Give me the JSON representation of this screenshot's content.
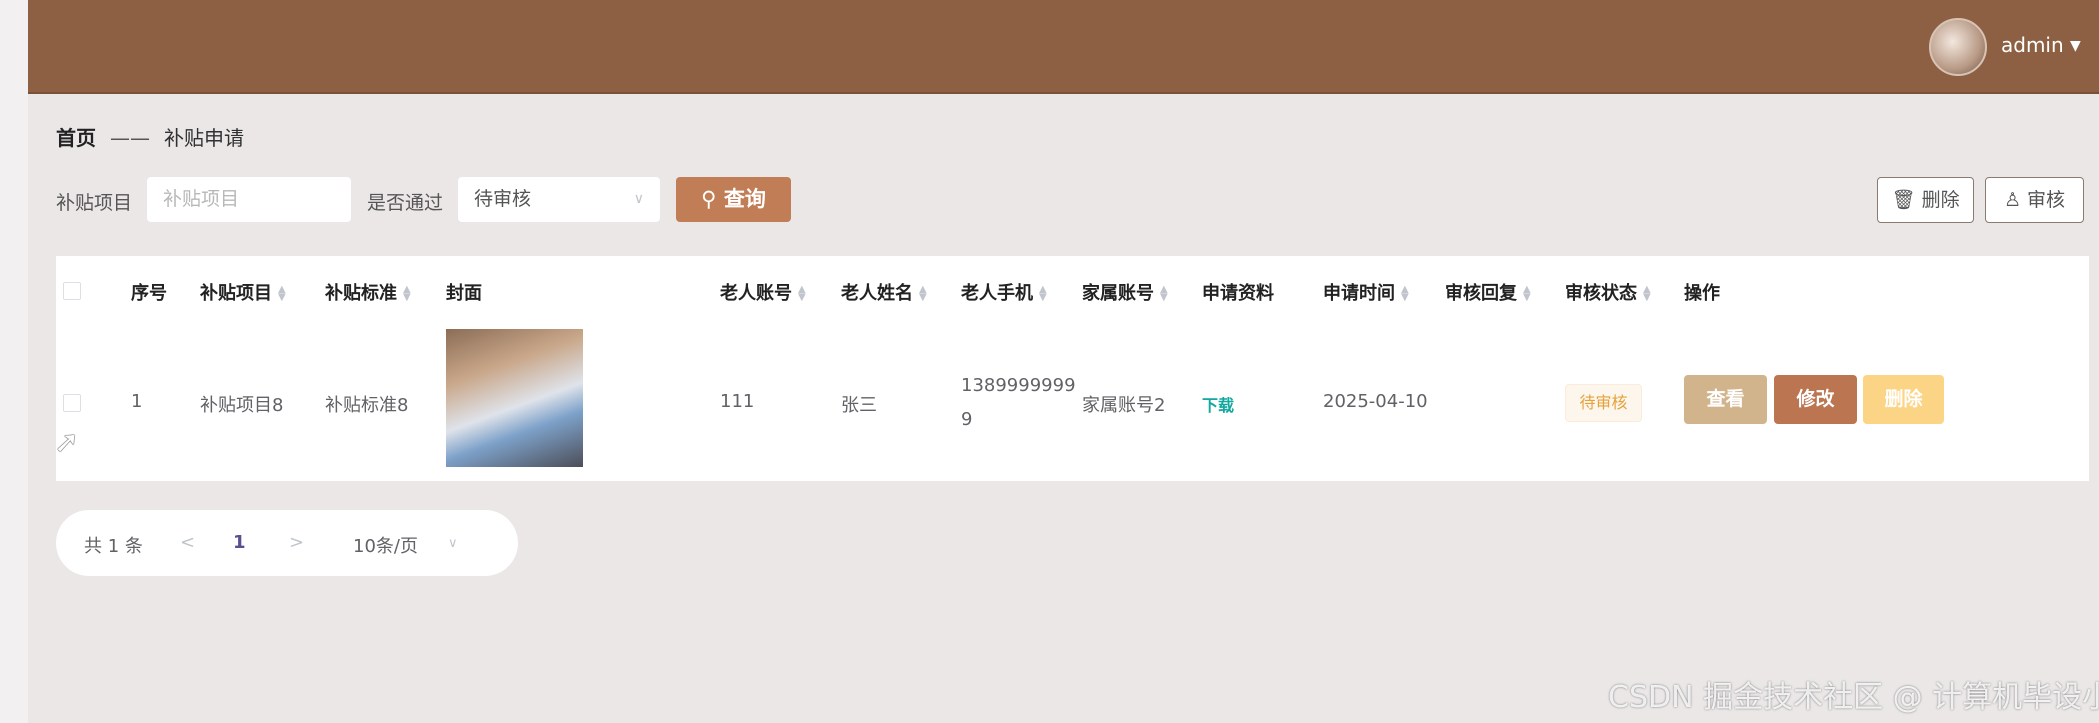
{
  "header": {
    "username": "admin"
  },
  "breadcrumb": {
    "home": "首页",
    "separator": "——",
    "current": "补贴申请"
  },
  "filters": {
    "project_label": "补贴项目",
    "project_placeholder": "补贴项目",
    "passed_label": "是否通过",
    "passed_value": "待审核",
    "query_label": "查询"
  },
  "actions": {
    "delete_label": "删除",
    "review_label": "审核"
  },
  "table": {
    "columns": [
      "序号",
      "补贴项目",
      "补贴标准",
      "封面",
      "老人账号",
      "老人姓名",
      "老人手机",
      "家属账号",
      "申请资料",
      "申请时间",
      "审核回复",
      "审核状态",
      "操作"
    ],
    "rows": [
      {
        "index": "1",
        "project": "补贴项目8",
        "standard": "补贴标准8",
        "account": "111",
        "name": "张三",
        "phone_line1": "1389999999",
        "phone_line2": "9",
        "family": "家属账号2",
        "material": "下载",
        "time": "2025-04-10",
        "reply": "",
        "status": "待审核",
        "view": "查看",
        "edit": "修改",
        "delete": "删除"
      }
    ]
  },
  "pagination": {
    "total": "共 1 条",
    "prev": "<",
    "page": "1",
    "next": ">",
    "page_size": "10条/页"
  },
  "watermark": "CSDN 掘金技术社区 @ 计算机毕设小月哥",
  "colors": {
    "header": "#8d6043",
    "primary": "#c17d55",
    "view": "#d2b48c",
    "edit": "#bb7550",
    "delete": "#fcd486"
  }
}
